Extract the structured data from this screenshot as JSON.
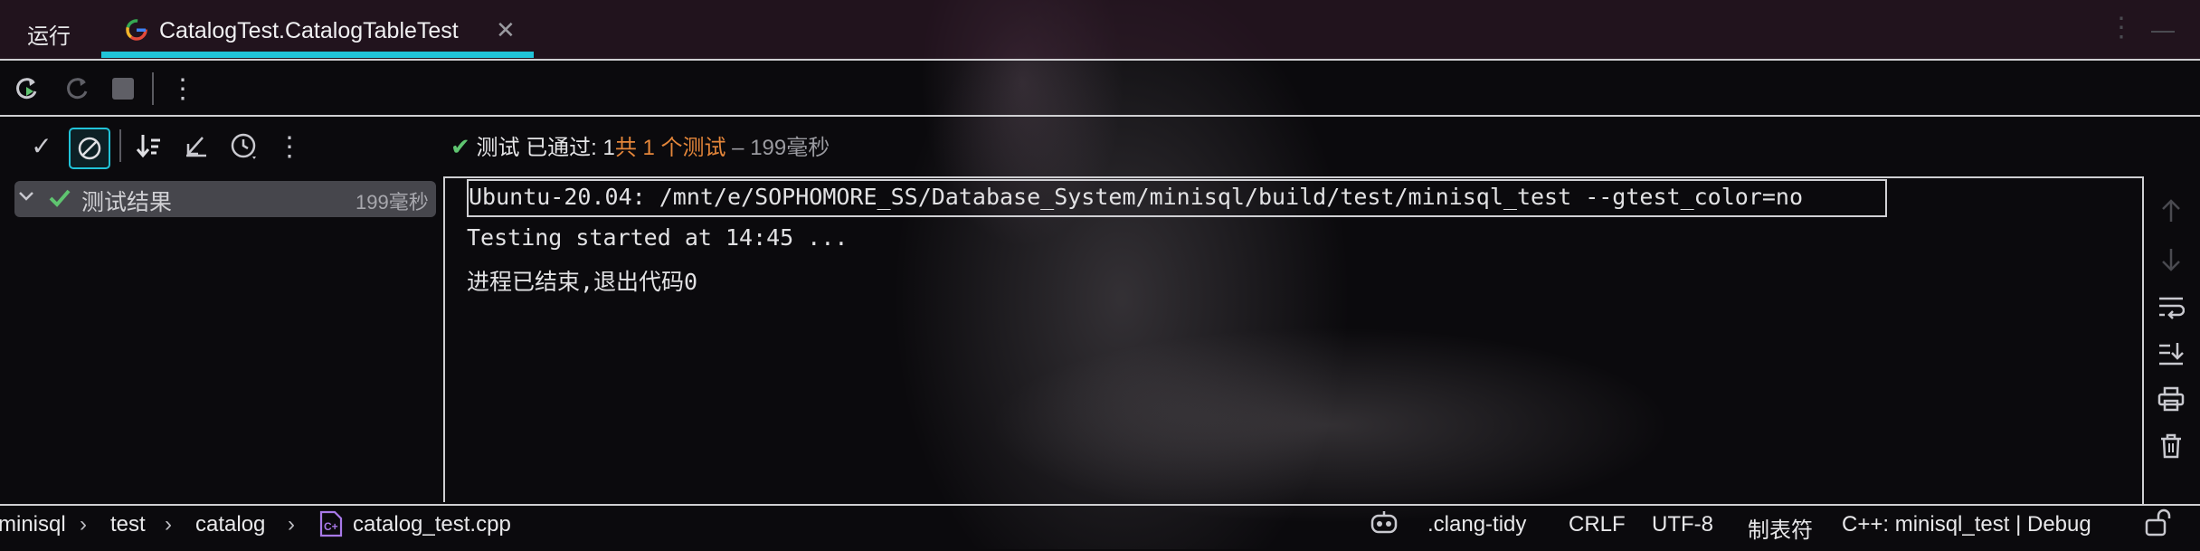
{
  "run_panel": {
    "run_label": "运行",
    "tab_title": "CatalogTest.CatalogTableTest",
    "tab_close": "✕"
  },
  "test_status": {
    "check": "✔",
    "prefix": "测试 已通过: 1",
    "total": "共 1 个测试",
    "duration": " – 199毫秒"
  },
  "tree": {
    "items": [
      {
        "label": "测试结果",
        "duration": "199毫秒",
        "expanded": true,
        "passed": true
      }
    ]
  },
  "console": {
    "lines": [
      "Ubuntu-20.04: /mnt/e/SOPHOMORE_SS/Database_System/minisql/build/test/minisql_test --gtest_color=no",
      "Testing started at 14:45 ...",
      "进程已结束,退出代码0"
    ]
  },
  "status_bar": {
    "breadcrumb": [
      "minisql",
      "test",
      "catalog",
      "catalog_test.cpp"
    ],
    "clang_tidy": ".clang-tidy",
    "line_ending": "CRLF",
    "encoding": "UTF-8",
    "indent": "制表符",
    "config": "C++: minisql_test | Debug"
  },
  "colors": {
    "accent": "#21c4d9",
    "pass_green": "#5fc470",
    "orange": "#e4863a"
  },
  "icons": [
    "rerun-icon",
    "rerun-failed-icon",
    "stop-icon",
    "more-icon",
    "show-passed-icon",
    "show-ignored-icon",
    "sort-icon",
    "collapse-icon",
    "history-icon",
    "scroll-up-icon",
    "scroll-down-icon",
    "soft-wrap-icon",
    "scroll-to-end-icon",
    "print-icon",
    "clear-icon"
  ]
}
